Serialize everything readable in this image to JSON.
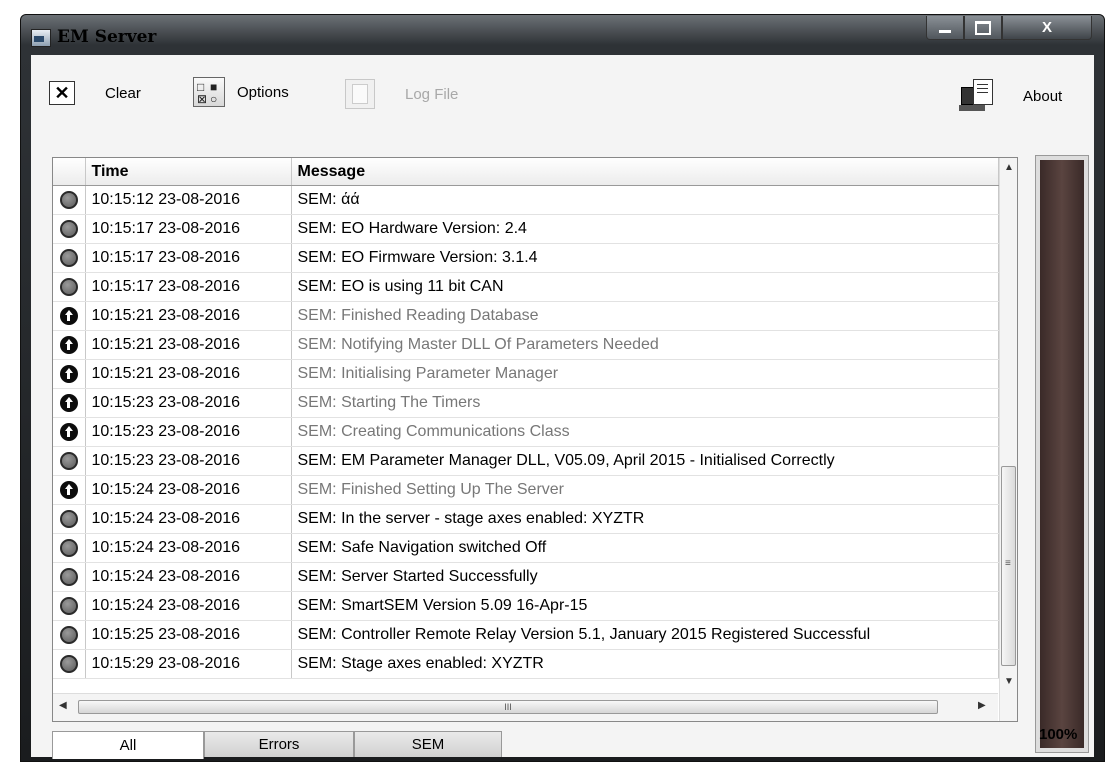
{
  "window": {
    "title": "EM Server",
    "controls": {
      "minimize": "",
      "maximize": "",
      "close": "X"
    }
  },
  "toolbar": {
    "clear_label": "Clear",
    "options_label": "Options",
    "logfile_label": "Log File",
    "about_label": "About",
    "clear_icon": "x-icon",
    "options_icon": "options-grid-icon",
    "logfile_icon": "document-icon",
    "about_icon": "computer-document-icon"
  },
  "log": {
    "columns": {
      "status": "",
      "time": "Time",
      "message": "Message"
    },
    "rows": [
      {
        "status": "info",
        "time": "10:15:12 23-08-2016",
        "message": "SEM: άά"
      },
      {
        "status": "info",
        "time": "10:15:17 23-08-2016",
        "message": "SEM: EO Hardware Version: 2.4"
      },
      {
        "status": "info",
        "time": "10:15:17 23-08-2016",
        "message": "SEM: EO Firmware Version: 3.1.4"
      },
      {
        "status": "info",
        "time": "10:15:17 23-08-2016",
        "message": "SEM: EO is using 11 bit CAN"
      },
      {
        "status": "up",
        "time": "10:15:21 23-08-2016",
        "message": "SEM: Finished Reading Database"
      },
      {
        "status": "up",
        "time": "10:15:21 23-08-2016",
        "message": "SEM: Notifying Master DLL Of Parameters Needed"
      },
      {
        "status": "up",
        "time": "10:15:21 23-08-2016",
        "message": "SEM: Initialising Parameter Manager"
      },
      {
        "status": "up",
        "time": "10:15:23 23-08-2016",
        "message": "SEM: Starting The Timers"
      },
      {
        "status": "up",
        "time": "10:15:23 23-08-2016",
        "message": "SEM: Creating Communications Class"
      },
      {
        "status": "info",
        "time": "10:15:23 23-08-2016",
        "message": "SEM: EM Parameter Manager DLL, V05.09, April 2015 - Initialised Correctly"
      },
      {
        "status": "up",
        "time": "10:15:24 23-08-2016",
        "message": "SEM: Finished Setting Up The Server"
      },
      {
        "status": "info",
        "time": "10:15:24 23-08-2016",
        "message": "SEM: In the server - stage axes enabled: XYZTR"
      },
      {
        "status": "info",
        "time": "10:15:24 23-08-2016",
        "message": "SEM: Safe Navigation switched Off"
      },
      {
        "status": "info",
        "time": "10:15:24 23-08-2016",
        "message": "SEM: Server Started Successfully"
      },
      {
        "status": "info",
        "time": "10:15:24 23-08-2016",
        "message": "SEM: SmartSEM Version 5.09   16-Apr-15"
      },
      {
        "status": "info",
        "time": "10:15:25 23-08-2016",
        "message": "SEM: Controller Remote Relay Version 5.1, January 2015 Registered Successful"
      },
      {
        "status": "info",
        "time": "10:15:29 23-08-2016",
        "message": "SEM: Stage axes enabled: XYZTR"
      }
    ]
  },
  "scrollbars": {
    "vertical_grip": "≡",
    "horizontal_grip": "III"
  },
  "progress": {
    "value_fraction": 1.0,
    "label": "100%"
  },
  "tabs": [
    {
      "label": "All",
      "active": true
    },
    {
      "label": "Errors",
      "active": false
    },
    {
      "label": "SEM",
      "active": false
    }
  ]
}
